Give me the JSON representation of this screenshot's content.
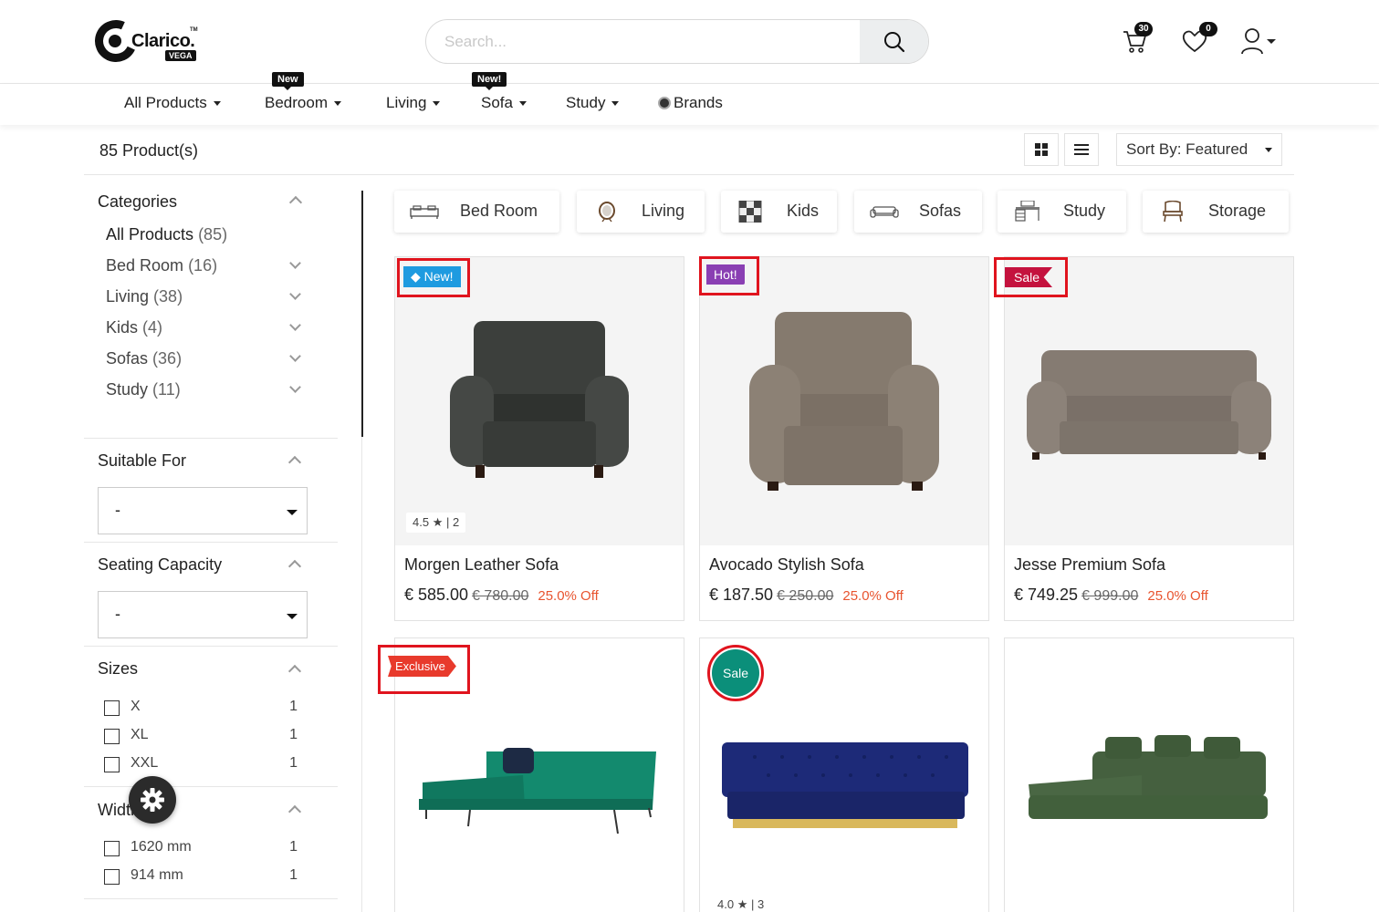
{
  "brand": {
    "name": "Clarico.",
    "sub": "VEGA",
    "tm": "TM"
  },
  "search": {
    "placeholder": "Search..."
  },
  "header": {
    "cart_count": "30",
    "wishlist_count": "0"
  },
  "nav": {
    "items": [
      {
        "label": "All Products"
      },
      {
        "label": "Bedroom",
        "tag": "New"
      },
      {
        "label": "Living"
      },
      {
        "label": "Sofa",
        "tag": "New!"
      },
      {
        "label": "Study"
      },
      {
        "label": "Brands"
      }
    ]
  },
  "toolbar": {
    "count": "85 Product(s)",
    "sort_label": "Sort By: Featured"
  },
  "sidebar": {
    "categories_title": "Categories",
    "categories": [
      {
        "label": "All Products",
        "count": "(85)"
      },
      {
        "label": "Bed Room",
        "count": "(16)"
      },
      {
        "label": "Living",
        "count": "(38)"
      },
      {
        "label": "Kids",
        "count": "(4)"
      },
      {
        "label": "Sofas",
        "count": "(36)"
      },
      {
        "label": "Study",
        "count": "(11)"
      }
    ],
    "suitable_title": "Suitable For",
    "suitable_value": "-",
    "seating_title": "Seating Capacity",
    "seating_value": "-",
    "sizes_title": "Sizes",
    "sizes": [
      {
        "label": "X",
        "count": "1"
      },
      {
        "label": "XL",
        "count": "1"
      },
      {
        "label": "XXL",
        "count": "1"
      }
    ],
    "width_title": "Width",
    "widths": [
      {
        "label": "1620 mm",
        "count": "1"
      },
      {
        "label": "914 mm",
        "count": "1"
      }
    ]
  },
  "chips": [
    {
      "label": "Bed Room",
      "icon": "bed-icon"
    },
    {
      "label": "Living",
      "icon": "mirror-icon"
    },
    {
      "label": "Kids",
      "icon": "checker-icon"
    },
    {
      "label": "Sofas",
      "icon": "sofa-icon"
    },
    {
      "label": "Study",
      "icon": "desk-icon"
    },
    {
      "label": "Storage",
      "icon": "chair-icon"
    }
  ],
  "products": [
    {
      "name": "Morgen Leather Sofa",
      "price": "€ 585.00",
      "old": "€ 780.00",
      "off": "25.0% Off",
      "label": "New!",
      "rating": "4.5",
      "reviews": "| 2",
      "color": "#3c3f3c"
    },
    {
      "name": "Avocado Stylish Sofa",
      "price": "€ 187.50",
      "old": "€ 250.00",
      "off": "25.0% Off",
      "label": "Hot!",
      "color": "#857a6e"
    },
    {
      "name": "Jesse Premium Sofa",
      "price": "€ 749.25",
      "old": "€ 999.00",
      "off": "25.0% Off",
      "label": "Sale",
      "color": "#857b72"
    },
    {
      "label": "Exclusive",
      "color": "#138a6e"
    },
    {
      "label": "Sale",
      "rating": "4.0",
      "reviews": "| 3",
      "color": "#1d2a78"
    },
    {
      "color": "#45603f"
    }
  ]
}
